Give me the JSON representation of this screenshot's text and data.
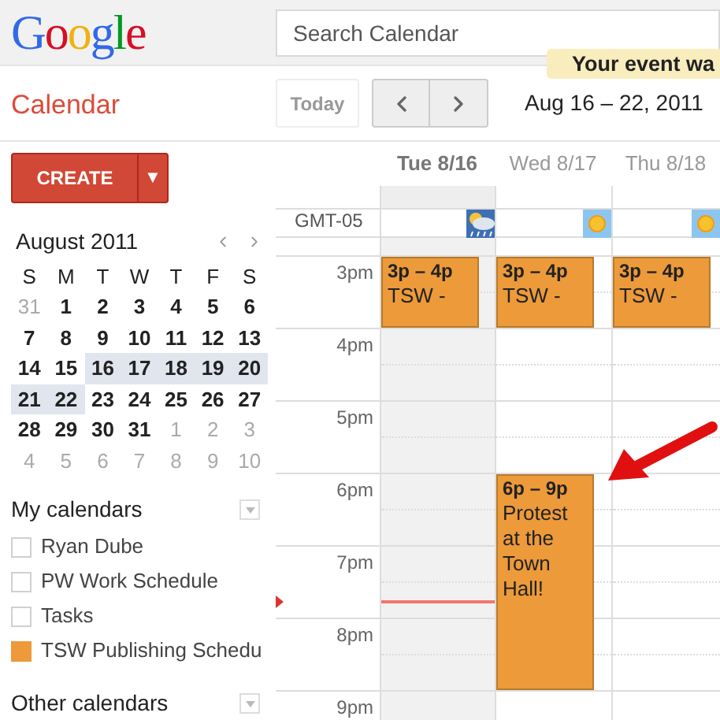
{
  "header": {
    "logo": "Google",
    "search": {
      "placeholder": "Search Calendar"
    },
    "notice": "Your event wa"
  },
  "app_title": "Calendar",
  "toolbar": {
    "today": "Today",
    "range": "Aug 16 – 22, 2011"
  },
  "create": {
    "label": "CREATE",
    "menu": "▼"
  },
  "mini_calendar": {
    "title": "August 2011",
    "weekdays": [
      "S",
      "M",
      "T",
      "W",
      "T",
      "F",
      "S"
    ],
    "weeks": [
      [
        {
          "day": "31",
          "other_month": true,
          "in_range": false
        },
        {
          "day": "1",
          "other_month": false,
          "in_range": false
        },
        {
          "day": "2",
          "other_month": false,
          "in_range": false
        },
        {
          "day": "3",
          "other_month": false,
          "in_range": false
        },
        {
          "day": "4",
          "other_month": false,
          "in_range": false
        },
        {
          "day": "5",
          "other_month": false,
          "in_range": false
        },
        {
          "day": "6",
          "other_month": false,
          "in_range": false
        }
      ],
      [
        {
          "day": "7",
          "other_month": false,
          "in_range": false
        },
        {
          "day": "8",
          "other_month": false,
          "in_range": false
        },
        {
          "day": "9",
          "other_month": false,
          "in_range": false
        },
        {
          "day": "10",
          "other_month": false,
          "in_range": false
        },
        {
          "day": "11",
          "other_month": false,
          "in_range": false
        },
        {
          "day": "12",
          "other_month": false,
          "in_range": false
        },
        {
          "day": "13",
          "other_month": false,
          "in_range": false
        }
      ],
      [
        {
          "day": "14",
          "other_month": false,
          "in_range": false
        },
        {
          "day": "15",
          "other_month": false,
          "in_range": false
        },
        {
          "day": "16",
          "other_month": false,
          "in_range": true
        },
        {
          "day": "17",
          "other_month": false,
          "in_range": true
        },
        {
          "day": "18",
          "other_month": false,
          "in_range": true
        },
        {
          "day": "19",
          "other_month": false,
          "in_range": true
        },
        {
          "day": "20",
          "other_month": false,
          "in_range": true
        }
      ],
      [
        {
          "day": "21",
          "other_month": false,
          "in_range": true
        },
        {
          "day": "22",
          "other_month": false,
          "in_range": true
        },
        {
          "day": "23",
          "other_month": false,
          "in_range": false
        },
        {
          "day": "24",
          "other_month": false,
          "in_range": false
        },
        {
          "day": "25",
          "other_month": false,
          "in_range": false
        },
        {
          "day": "26",
          "other_month": false,
          "in_range": false
        },
        {
          "day": "27",
          "other_month": false,
          "in_range": false
        }
      ],
      [
        {
          "day": "28",
          "other_month": false,
          "in_range": false
        },
        {
          "day": "29",
          "other_month": false,
          "in_range": false
        },
        {
          "day": "30",
          "other_month": false,
          "in_range": false
        },
        {
          "day": "31",
          "other_month": false,
          "in_range": false
        },
        {
          "day": "1",
          "other_month": true,
          "in_range": false
        },
        {
          "day": "2",
          "other_month": true,
          "in_range": false
        },
        {
          "day": "3",
          "other_month": true,
          "in_range": false
        }
      ],
      [
        {
          "day": "4",
          "other_month": true,
          "in_range": false
        },
        {
          "day": "5",
          "other_month": true,
          "in_range": false
        },
        {
          "day": "6",
          "other_month": true,
          "in_range": false
        },
        {
          "day": "7",
          "other_month": true,
          "in_range": false
        },
        {
          "day": "8",
          "other_month": true,
          "in_range": false
        },
        {
          "day": "9",
          "other_month": true,
          "in_range": false
        },
        {
          "day": "10",
          "other_month": true,
          "in_range": false
        }
      ]
    ]
  },
  "my_calendars": {
    "title": "My calendars",
    "items": [
      {
        "name": "Ryan Dube",
        "checked": false
      },
      {
        "name": "PW Work Schedule",
        "checked": false
      },
      {
        "name": "Tasks",
        "checked": false
      },
      {
        "name": "TSW Publishing Schedu",
        "checked": true,
        "color": "#ec9a3a"
      }
    ]
  },
  "other_calendars": {
    "title": "Other calendars"
  },
  "week": {
    "timezone": "GMT-05",
    "days": [
      {
        "label": "Tue 8/16",
        "today": true,
        "weather": {
          "kind": "rain"
        }
      },
      {
        "label": "Wed 8/17",
        "today": false,
        "weather": {
          "kind": "sun"
        }
      },
      {
        "label": "Thu 8/18",
        "today": false,
        "weather": {
          "kind": "sun"
        }
      }
    ],
    "rows": [
      {
        "time": "3pm",
        "cells": [
          {
            "kind": "hour_event",
            "time": "3p – 4p",
            "title": "TSW -"
          },
          {
            "kind": "hour_event",
            "time": "3p – 4p",
            "title": "TSW -"
          },
          {
            "kind": "hour_event",
            "time": "3p – 4p",
            "title": "TSW -"
          }
        ]
      },
      {
        "time": "4pm",
        "cells": [
          {
            "kind": "empty"
          },
          {
            "kind": "empty"
          },
          {
            "kind": "empty"
          }
        ]
      },
      {
        "time": "5pm",
        "cells": [
          {
            "kind": "empty"
          },
          {
            "kind": "empty"
          },
          {
            "kind": "empty"
          }
        ]
      },
      {
        "time": "6pm",
        "cells": [
          {
            "kind": "empty"
          },
          {
            "kind": "three_hour_event",
            "time": "6p – 9p",
            "title": "Protest at the Town Hall!"
          },
          {
            "kind": "empty"
          }
        ]
      },
      {
        "time": "7pm",
        "cells": [
          {
            "kind": "now"
          },
          {
            "kind": "empty"
          },
          {
            "kind": "empty"
          }
        ]
      },
      {
        "time": "8pm",
        "cells": [
          {
            "kind": "empty"
          },
          {
            "kind": "empty"
          },
          {
            "kind": "empty"
          }
        ]
      },
      {
        "time": "9pm",
        "cells": [
          {
            "kind": "empty"
          },
          {
            "kind": "empty"
          },
          {
            "kind": "empty"
          }
        ]
      }
    ]
  }
}
